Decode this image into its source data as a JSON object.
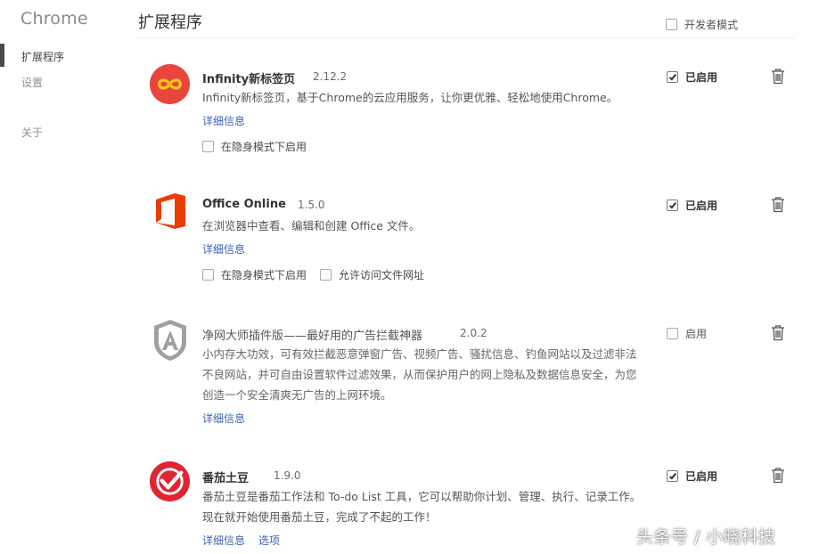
{
  "sidebar": {
    "brand": "Chrome",
    "items": [
      {
        "label": "扩展程序"
      },
      {
        "label": "设置"
      },
      {
        "label": "关于"
      }
    ]
  },
  "header": {
    "title": "扩展程序",
    "dev_mode_label": "开发者模式"
  },
  "extensions": [
    {
      "name": "Infinity新标签页",
      "version": "2.12.2",
      "description": "Infinity新标签页，基于Chrome的云应用服务，让你更优雅、轻松地使用Chrome。",
      "details_link": "详细信息",
      "options": [
        "在隐身模式下启用"
      ],
      "enabled_label": "已启用",
      "icon": "infinity-icon",
      "color": "#e8453c"
    },
    {
      "name": "Office Online",
      "version": "1.5.0",
      "description": "在浏览器中查看、编辑和创建 Office 文件。",
      "details_link": "详细信息",
      "options": [
        "在隐身模式下启用",
        "允许访问文件网址"
      ],
      "enabled_label": "已启用",
      "icon": "office-icon",
      "color": "#eb3c00"
    },
    {
      "name": "净网大师插件版——最好用的广告拦截神器",
      "version": "2.0.2",
      "description_lines": [
        "小内存大功效，可有效拦截恶意弹窗广告、视频广告、骚扰信息、钓鱼网站以及过滤非法",
        "不良网站，并可自由设置软件过滤效果，从而保护用户的网上隐私及数据信息安全，为您",
        "创造一个安全清爽无广告的上网环境。"
      ],
      "details_link": "详细信息",
      "enabled_label": "启用",
      "icon": "shield-a-icon",
      "color": "#9a9a9a"
    },
    {
      "name": "番茄土豆",
      "version": "1.9.0",
      "description_lines": [
        "番茄土豆是番茄工作法和 To-do List 工具，它可以帮助你计划、管理、执行、记录工作。",
        "现在就开始使用番茄土豆，完成了不起的工作！"
      ],
      "details_link": "详细信息",
      "options_link": "选项",
      "enabled_label": "已启用",
      "icon": "check-circle-icon",
      "color": "#e0252f"
    }
  ],
  "watermark": "头条号 / 小晓科技"
}
